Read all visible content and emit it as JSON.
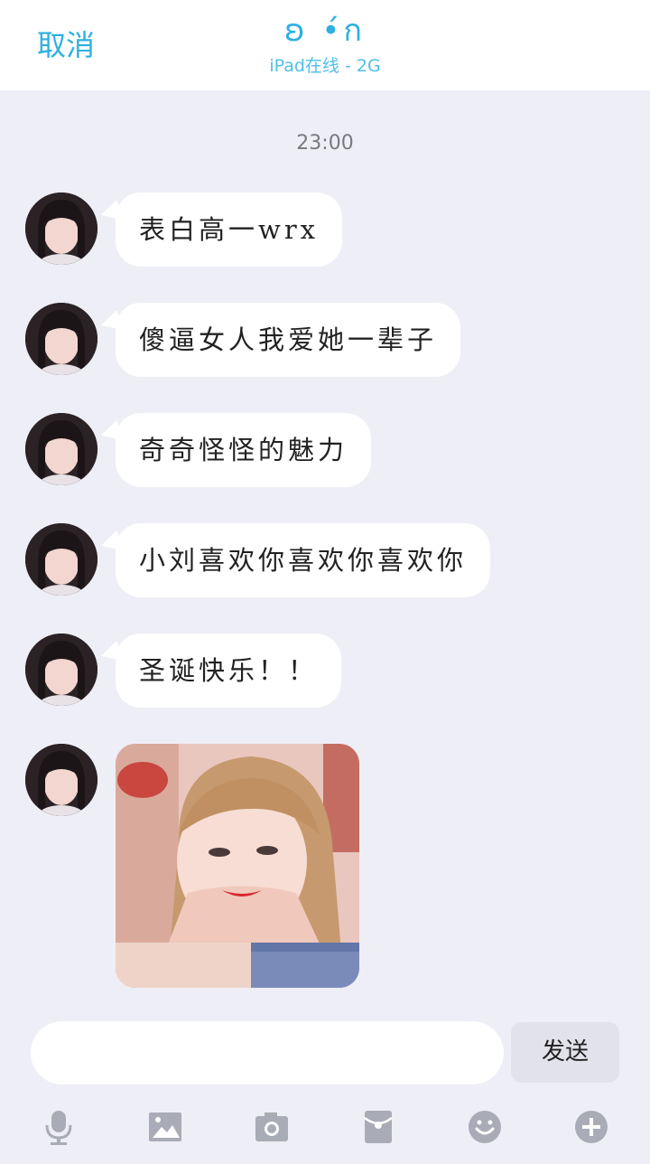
{
  "header": {
    "cancel_label": "取消",
    "title": "ʚ •́ก",
    "subtitle": "iPad在线 - 2G"
  },
  "chat": {
    "timestamp": "23:00",
    "messages": [
      {
        "text": "表白高一wrx"
      },
      {
        "text": "傻逼女人我爱她一辈子"
      },
      {
        "text": "奇奇怪怪的魅力"
      },
      {
        "text": "小刘喜欢你喜欢你喜欢你"
      },
      {
        "text": "圣诞快乐！！"
      }
    ]
  },
  "composer": {
    "input_value": "",
    "send_label": "发送"
  },
  "toolbar": {
    "items": [
      "microphone-icon",
      "image-icon",
      "camera-icon",
      "red-packet-icon",
      "emoji-icon",
      "plus-icon"
    ]
  },
  "colors": {
    "accent": "#2db0e0",
    "background": "#eeeef6",
    "bubble": "#ffffff",
    "icon_gray": "#a9acb6"
  }
}
